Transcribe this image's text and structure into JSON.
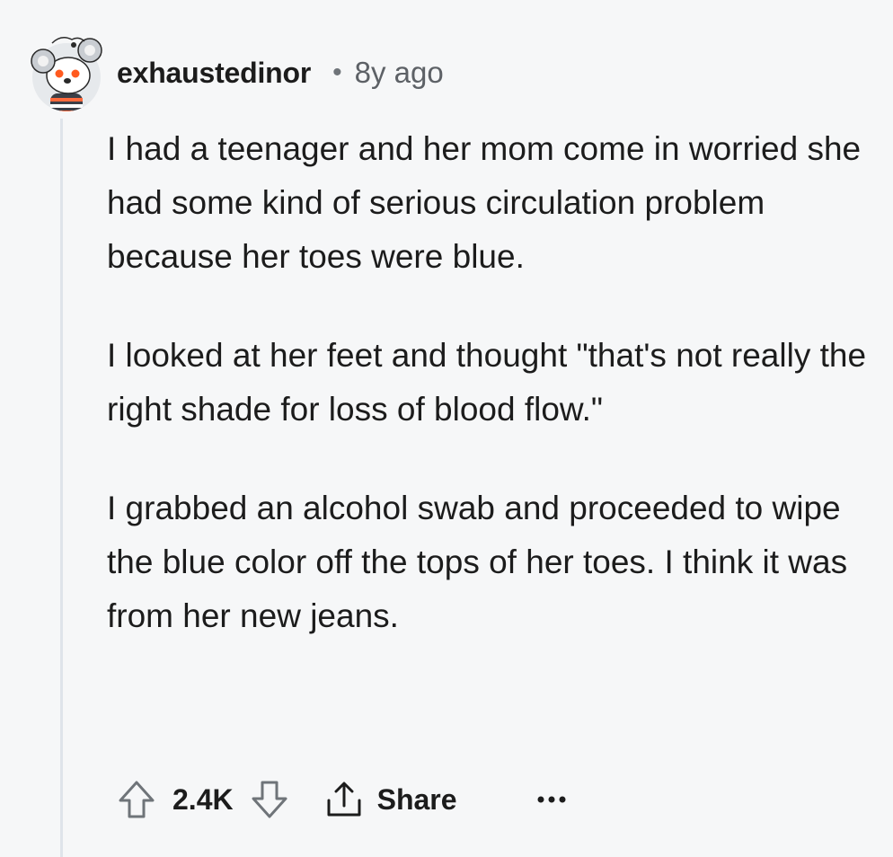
{
  "comment": {
    "author": "exhaustedinor",
    "separator": "•",
    "timestamp": "8y ago",
    "avatar_icon": "koala-avatar-icon",
    "paragraphs": [
      "I had a teenager and her mom come in worried she had some kind of serious circulation problem because her toes were blue.",
      "I looked at her feet and thought \"that's not really the right shade for loss of blood flow.\"",
      "I grabbed an alcohol swab and proceeded to wipe the blue color off the tops of her toes. I think it was from her new jeans."
    ]
  },
  "actions": {
    "upvote_icon": "arrow-up-icon",
    "vote_count": "2.4K",
    "downvote_icon": "arrow-down-icon",
    "share_icon": "share-icon",
    "share_label": "Share",
    "more_icon": "more-dots-icon"
  },
  "colors": {
    "background": "#f6f7f8",
    "text": "#1c1c1c",
    "meta": "#5d6166",
    "thread_line": "#dfe4ea"
  }
}
